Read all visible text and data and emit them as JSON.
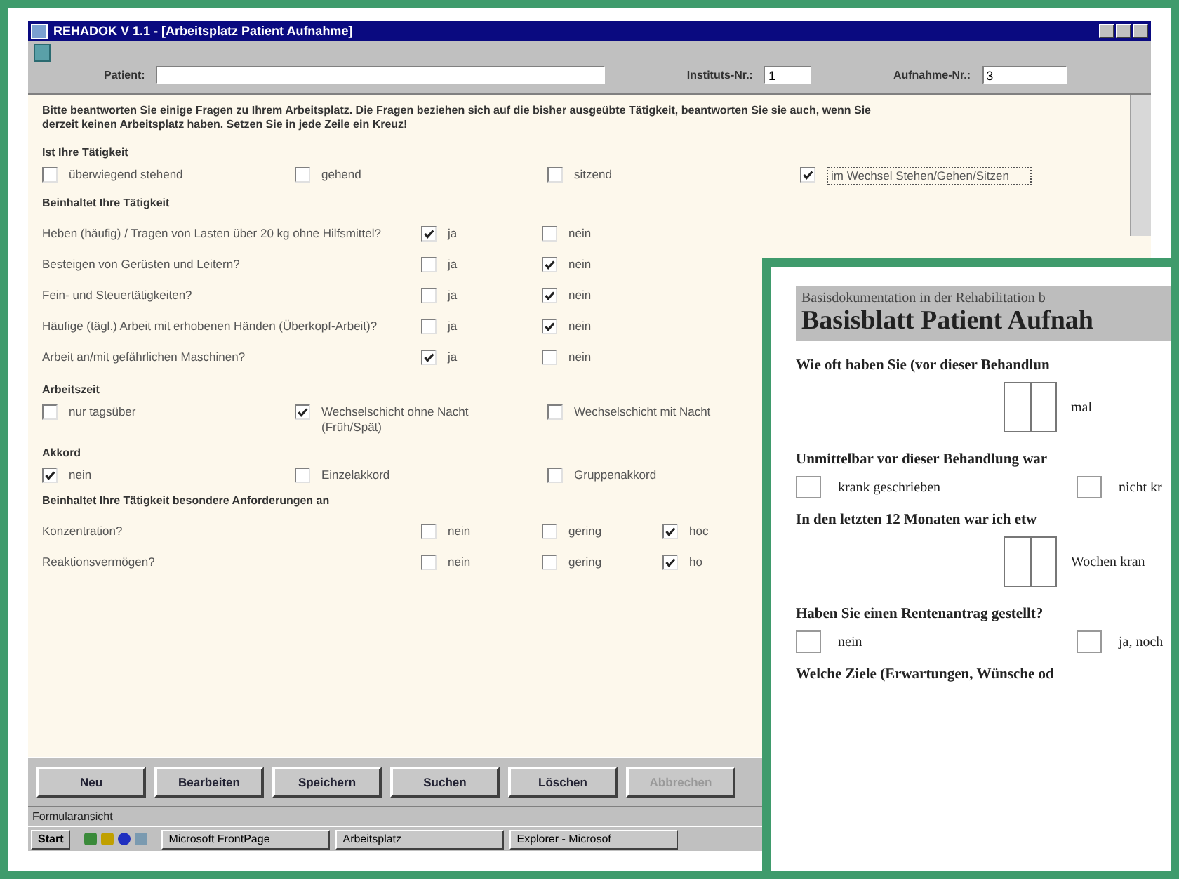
{
  "window": {
    "title": "REHADOK V 1.1 - [Arbeitsplatz Patient Aufnahme]"
  },
  "header_fields": [
    {
      "label": "Patient:"
    },
    {
      "label": "Instituts-Nr.:",
      "value": "1"
    },
    {
      "label": "Aufnahme-Nr.:",
      "value": "3"
    }
  ],
  "intro": "Bitte beantworten Sie einige Fragen zu Ihrem Arbeitsplatz. Die Fragen beziehen sich auf die bisher ausgeübte Tätigkeit, beantworten Sie sie auch, wenn Sie derzeit keinen Arbeitsplatz haben. Setzen Sie in jede Zeile ein Kreuz!",
  "sections": [
    {
      "kind": "options",
      "heading": "Ist Ihre Tätigkeit",
      "options": [
        {
          "label": "überwiegend stehend",
          "checked": false
        },
        {
          "label": "gehend",
          "checked": false
        },
        {
          "label": "sitzend",
          "checked": false
        },
        {
          "label": "im Wechsel Stehen/Gehen/Sitzen",
          "checked": true
        }
      ]
    },
    {
      "kind": "questions",
      "heading": "Beinhaltet Ihre Tätigkeit",
      "rows": [
        {
          "question": "Heben (häufig) / Tragen von Lasten über 20 kg ohne Hilfsmittel?",
          "options": [
            {
              "label": "ja",
              "checked": true
            },
            {
              "label": "nein",
              "checked": false
            }
          ]
        },
        {
          "question": "Besteigen von Gerüsten und Leitern?",
          "options": [
            {
              "label": "ja",
              "checked": false
            },
            {
              "label": "nein",
              "checked": true
            }
          ]
        },
        {
          "question": "Fein- und Steuertätigkeiten?",
          "options": [
            {
              "label": "ja",
              "checked": false
            },
            {
              "label": "nein",
              "checked": true
            }
          ]
        },
        {
          "question": "Häufige (tägl.) Arbeit mit erhobenen Händen (Überkopf-Arbeit)?",
          "options": [
            {
              "label": "ja",
              "checked": false
            },
            {
              "label": "nein",
              "checked": true
            }
          ]
        },
        {
          "question": "Arbeit an/mit gefährlichen Maschinen?",
          "options": [
            {
              "label": "ja",
              "checked": true
            },
            {
              "label": "nein",
              "checked": false
            }
          ]
        }
      ]
    },
    {
      "kind": "options",
      "heading": "Arbeitszeit",
      "options": [
        {
          "label": "nur tagsüber",
          "checked": false
        },
        {
          "label": "Wechselschicht ohne Nacht (Früh/Spät)",
          "checked": true
        },
        {
          "label": "Wechselschicht mit Nacht",
          "checked": false
        }
      ]
    },
    {
      "kind": "options",
      "heading": "Akkord",
      "options": [
        {
          "label": "nein",
          "checked": true
        },
        {
          "label": "Einzelakkord",
          "checked": false
        },
        {
          "label": "Gruppenakkord",
          "checked": false
        }
      ]
    },
    {
      "kind": "questions",
      "heading": "Beinhaltet Ihre Tätigkeit besondere Anforderungen an",
      "rows": [
        {
          "question": "Konzentration?",
          "options": [
            {
              "label": "nein",
              "checked": false
            },
            {
              "label": "gering",
              "checked": false
            },
            {
              "label": "hoc",
              "checked": true
            }
          ]
        },
        {
          "question": "Reaktionsvermögen?",
          "options": [
            {
              "label": "nein",
              "checked": false
            },
            {
              "label": "gering",
              "checked": false
            },
            {
              "label": "ho",
              "checked": true
            }
          ]
        }
      ]
    }
  ],
  "buttons": [
    {
      "label": "Neu",
      "disabled": false
    },
    {
      "label": "Bearbeiten",
      "disabled": false
    },
    {
      "label": "Speichern",
      "disabled": false
    },
    {
      "label": "Suchen",
      "disabled": false
    },
    {
      "label": "Löschen",
      "disabled": false
    },
    {
      "label": "Abbrechen",
      "disabled": true
    }
  ],
  "status_bar": "Formularansicht",
  "taskbar": {
    "start": "Start",
    "items": [
      {
        "label": "Microsoft FrontPage"
      },
      {
        "label": "Arbeitsplatz"
      },
      {
        "label": "Explorer - Microsof"
      }
    ]
  },
  "paper_form": {
    "subtitle": "Basisdokumentation in der Rehabilitation b",
    "title": "Basisblatt Patient Aufnah",
    "blocks": [
      {
        "kind": "question",
        "text": "Wie oft haben Sie (vor dieser Behandlun"
      },
      {
        "kind": "boxes",
        "label": "mal"
      },
      {
        "kind": "question",
        "text": "Unmittelbar vor dieser Behandlung war"
      },
      {
        "kind": "checks",
        "options": [
          {
            "label": "krank geschrieben",
            "checked": false
          },
          {
            "label": "nicht kr",
            "checked": false
          }
        ]
      },
      {
        "kind": "question",
        "text": "In den letzten 12 Monaten war ich etw"
      },
      {
        "kind": "boxes",
        "label": "Wochen kran"
      },
      {
        "kind": "question",
        "text": "Haben Sie einen Rentenantrag gestellt?"
      },
      {
        "kind": "checks",
        "options": [
          {
            "label": "nein",
            "checked": false
          },
          {
            "label": "ja, noch",
            "checked": false
          }
        ]
      },
      {
        "kind": "question",
        "text": "Welche Ziele (Erwartungen, Wünsche od"
      }
    ]
  }
}
